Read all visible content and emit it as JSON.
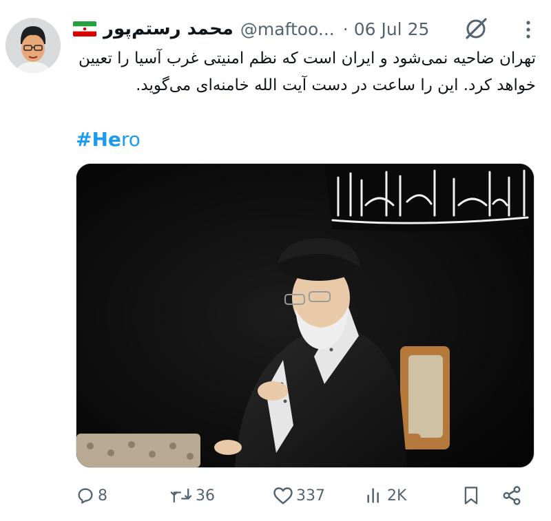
{
  "tweet": {
    "display_name": "محمد رستم‌پور",
    "handle": "@maftoo...",
    "separator": "·",
    "date": "06 Jul 25",
    "text": "تهران ضاحیه نمی‌شود و ایران است که نظم امنیتی غرب آسیا را تعیین خواهد کرد. این را ساعت در دست آیت الله خامنه‌ای می‌گوید.",
    "hashtag_bold": "#He",
    "hashtag_rest": "ro",
    "image_banner_text": "السلام علیک یا اباعبدالله"
  },
  "actions": {
    "replies": "8",
    "reposts": "36",
    "likes": "337",
    "views": "2K"
  },
  "icons": {
    "flag": "iran-flag-icon",
    "grok": "grok-icon",
    "more": "more-options-icon",
    "reply": "reply-icon",
    "repost": "repost-icon",
    "like": "heart-icon",
    "views": "views-icon",
    "bookmark": "bookmark-icon",
    "share": "share-icon"
  },
  "colors": {
    "text": "#0f1419",
    "secondary": "#536471",
    "link": "#1d9bf0"
  }
}
